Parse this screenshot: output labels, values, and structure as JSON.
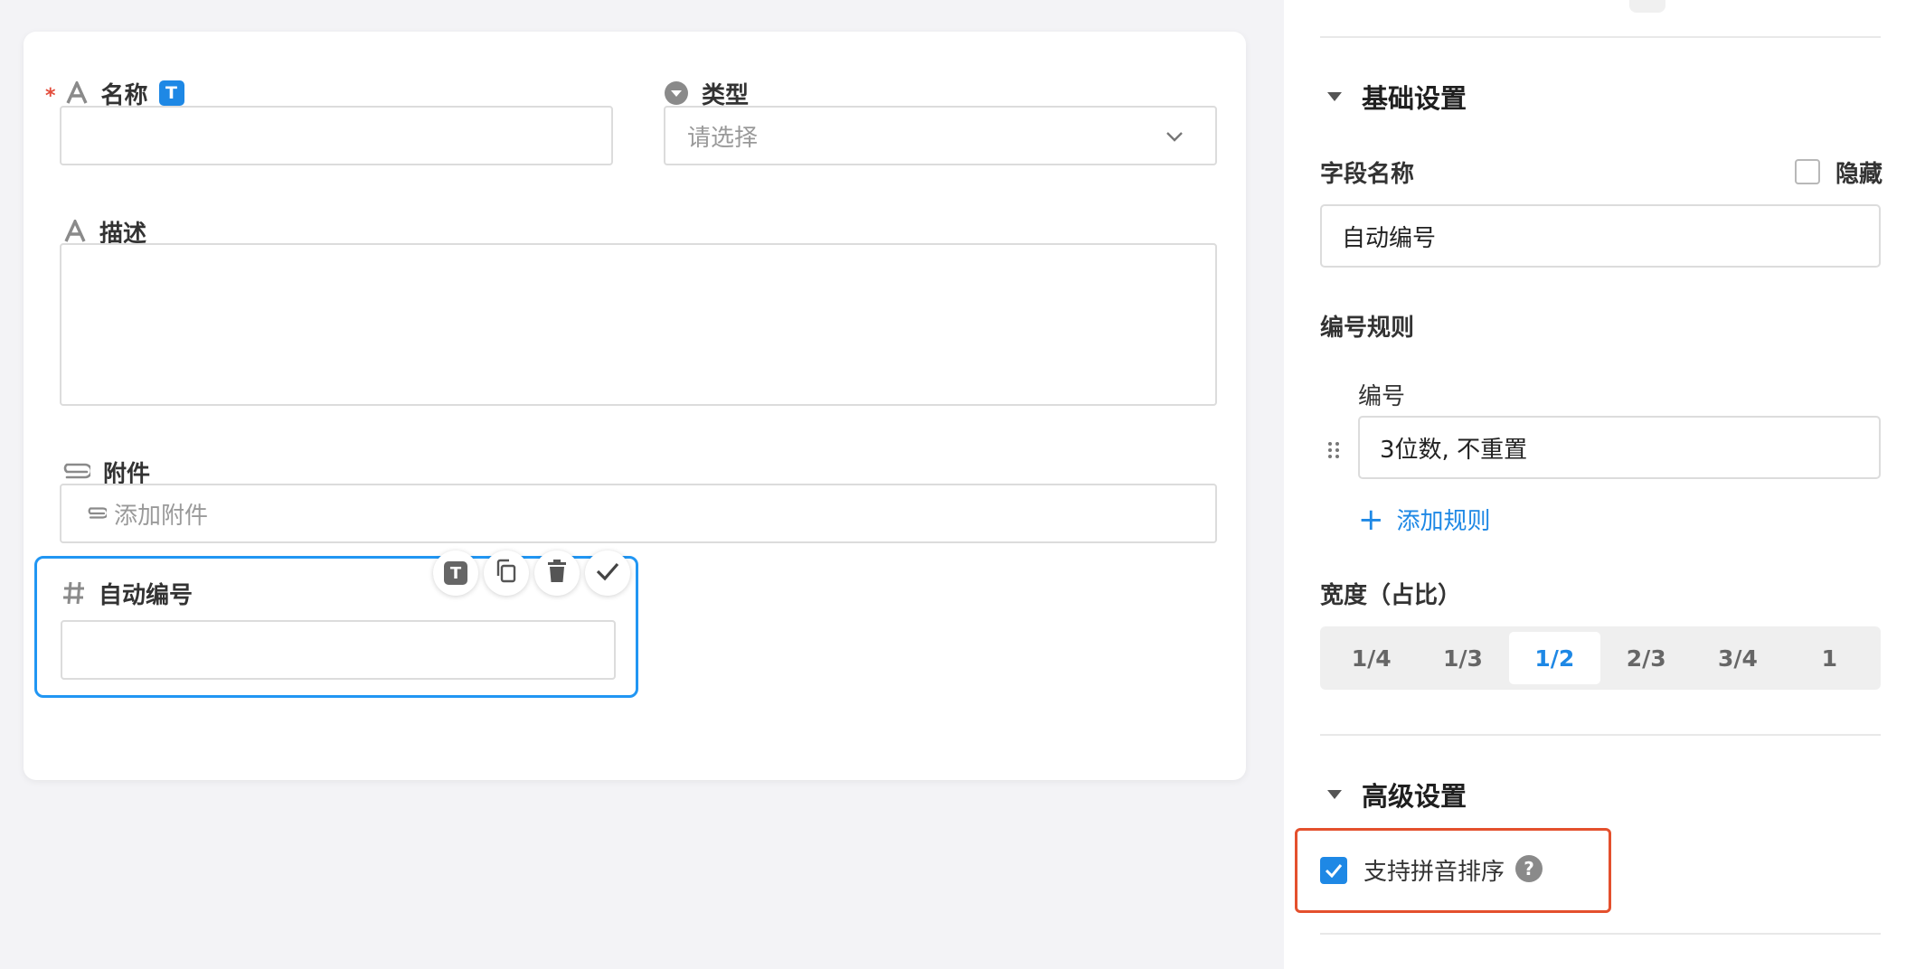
{
  "form": {
    "name_label": "名称",
    "name_badge": "T",
    "type_label": "类型",
    "type_placeholder": "请选择",
    "desc_label": "描述",
    "attach_label": "附件",
    "attach_placeholder": "添加附件",
    "auto_label": "自动编号",
    "toolbar": [
      "T",
      "copy",
      "delete",
      "confirm"
    ]
  },
  "panel": {
    "basic_title": "基础设置",
    "field_name_label": "字段名称",
    "hide_label": "隐藏",
    "field_name_value": "自动编号",
    "rule_label": "编号规则",
    "rule_item_label": "编号",
    "rule_item_value": "3位数, 不重置",
    "add_rule": "添加规则",
    "width_label": "宽度（占比）",
    "width_options": [
      "1/4",
      "1/3",
      "1/2",
      "2/3",
      "3/4",
      "1"
    ],
    "width_selected": "1/2",
    "advanced_title": "高级设置",
    "pinyin_label": "支持拼音排序"
  },
  "colors": {
    "accent": "#1e88e5",
    "selected_border": "#2196f3",
    "highlight_box": "#e4502d",
    "required": "#e34d3c"
  }
}
